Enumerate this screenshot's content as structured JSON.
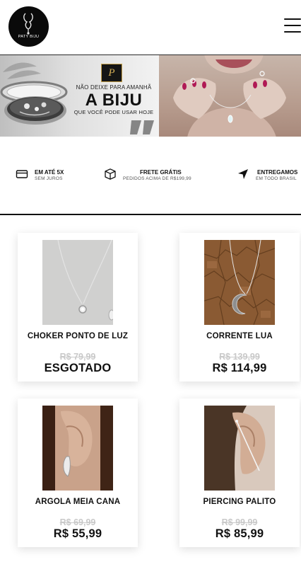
{
  "header": {
    "logo_text": "PATY BIJU"
  },
  "banner": {
    "badge_letter": "P",
    "line1": "NÃO DEIXE PARA AMANHÃ",
    "line2": "A BIJU",
    "line3": "QUE VOCÊ PODE USAR HOJE"
  },
  "features": [
    {
      "icon": "credit-card-icon",
      "title": "EM ATÉ 5X",
      "subtitle": "SEM JUROS"
    },
    {
      "icon": "box-icon",
      "title": "FRETE GRÁTIS",
      "subtitle": "PEDIDOS ACIMA DE R$199,99"
    },
    {
      "icon": "send-icon",
      "title": "ENTREGAMOS",
      "subtitle": "EM TODO BRASIL"
    }
  ],
  "products": [
    {
      "name": "CHOKER PONTO DE LUZ",
      "old_price": "R$ 79,99",
      "price": "ESGOTADO"
    },
    {
      "name": "CORRENTE LUA",
      "old_price": "R$ 139,99",
      "price": "R$ 114,99"
    },
    {
      "name": "ARGOLA MEIA CANA",
      "old_price": "R$ 69,99",
      "price": "R$ 55,99"
    },
    {
      "name": "PIERCING PALITO",
      "old_price": "R$ 99,99",
      "price": "R$ 85,99"
    }
  ],
  "colors": {
    "text": "#111111",
    "strike_price": "#c9c9c9",
    "badge_gold": "#d4ae55"
  }
}
